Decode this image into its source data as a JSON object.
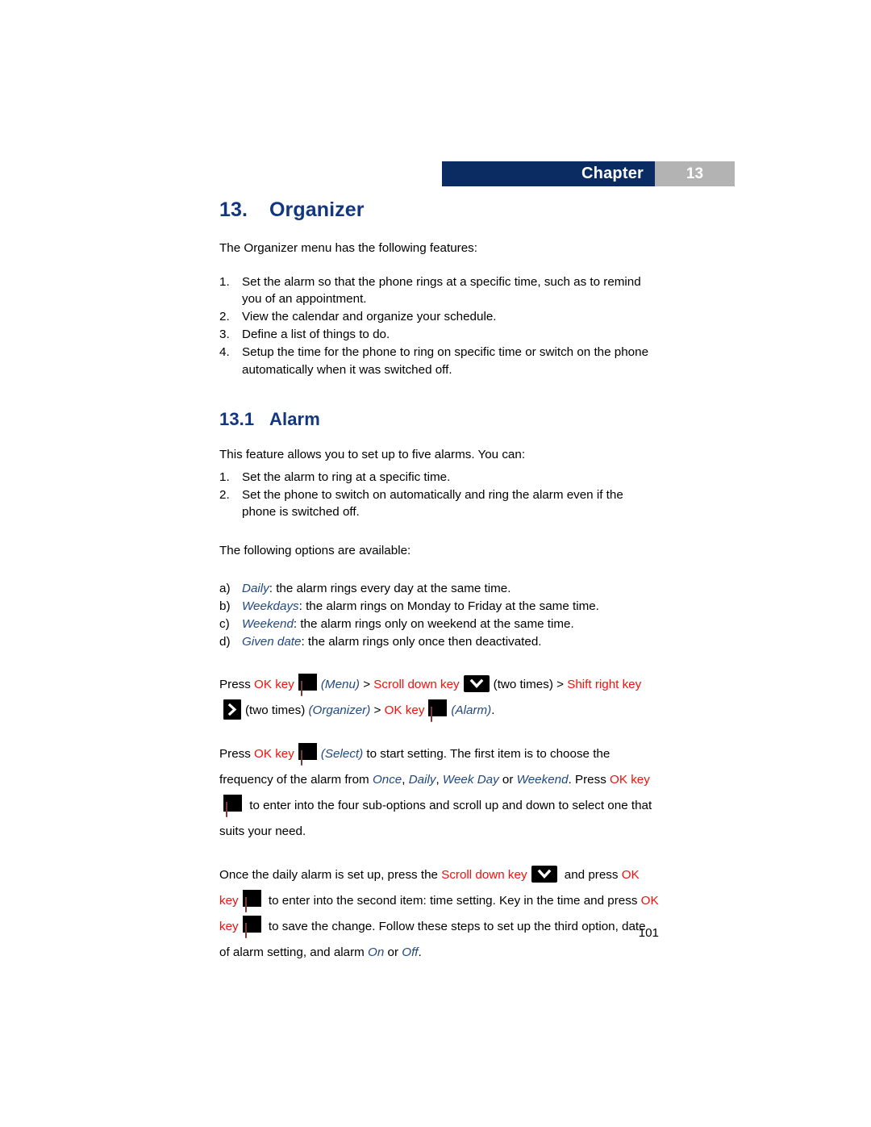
{
  "header": {
    "chapter_label": "Chapter",
    "chapter_number": "13",
    "navy_color": "#0b2c63",
    "gray_color": "#b3b3b3"
  },
  "title": {
    "number": "13.",
    "text": "Organizer",
    "color": "#12367f"
  },
  "intro": {
    "lead": "The Organizer menu has the following features:",
    "items": [
      {
        "marker": "1.",
        "text": "Set the alarm so that the phone rings at a specific time, such as to remind you of an appointment."
      },
      {
        "marker": "2.",
        "text": "View the calendar and organize your schedule."
      },
      {
        "marker": "3.",
        "text": "Define a list of things to do."
      },
      {
        "marker": "4.",
        "text": "Setup the time for the phone to ring on specific time or switch on the phone automatically when it was switched off."
      }
    ]
  },
  "section": {
    "number": "13.1",
    "text": "Alarm",
    "lead": "This feature allows you to set up to five alarms. You can:",
    "items": [
      {
        "marker": "1.",
        "text": "Set the alarm to ring at a specific time."
      },
      {
        "marker": "2.",
        "text": "Set the phone to switch on automatically and ring the alarm even if the phone is switched off."
      }
    ]
  },
  "options": {
    "lead": "The following options are available:",
    "items": [
      {
        "marker": "a)",
        "term": "Daily",
        "text": ": the alarm rings every day at the same time."
      },
      {
        "marker": "b)",
        "term": "Weekdays",
        "text": ": the alarm rings on Monday to Friday at the same time."
      },
      {
        "marker": "c)",
        "term": "Weekend",
        "text": ": the alarm rings only on weekend at the same time."
      },
      {
        "marker": "d)",
        "term": "Given date",
        "text": ": the alarm rings only once then deactivated."
      }
    ]
  },
  "steps": {
    "nav": {
      "press": "Press ",
      "ok_key_1": "OK key",
      "menu": "(Menu)",
      "gt_1": " > ",
      "scroll_down_key": "Scroll down key",
      "two_times_1": "(two times) > ",
      "shift_right_key": "Shift right key",
      "two_times_2": "(two times) ",
      "organizer": "(Organizer)",
      "gt_2": " > ",
      "ok_key_2": "OK key",
      "alarm": "(Alarm)",
      "period": "."
    },
    "setting": {
      "press": "Press ",
      "ok_key": "OK key",
      "select": "(Select)",
      "after_select": " to start setting. The first item is to choose the frequency of the alarm from ",
      "freq_once": "Once",
      "freq_sep_1": ", ",
      "freq_daily": "Daily",
      "freq_sep_2": ", ",
      "freq_weekday": "Week Day",
      "freq_sep_3": " or ",
      "freq_weekend": "Weekend",
      "after_freq": ". Press ",
      "ok_red": "OK key",
      "tail": " to enter into the four sub-options and scroll up and down to select one that suits your need."
    },
    "time": {
      "lead": "Once the daily alarm is set up, press the ",
      "scroll_down_key": "Scroll down key",
      "and_press": " and press ",
      "ok_key_1": "OK key",
      "mid": " to enter into the second item: time setting. Key in the time and press ",
      "ok_key_2": "OK key",
      "after_ok": " to save the change. Follow these steps to set up the third option, date of alarm setting, and alarm ",
      "on": "On",
      "or": " or ",
      "off": "Off",
      "period": "."
    }
  },
  "footer": {
    "page_number": "101"
  },
  "icons": {
    "ok_key": "ok-key-icon",
    "scroll_down_key": "scroll-down-key-icon",
    "shift_right_key": "shift-right-key-icon"
  }
}
